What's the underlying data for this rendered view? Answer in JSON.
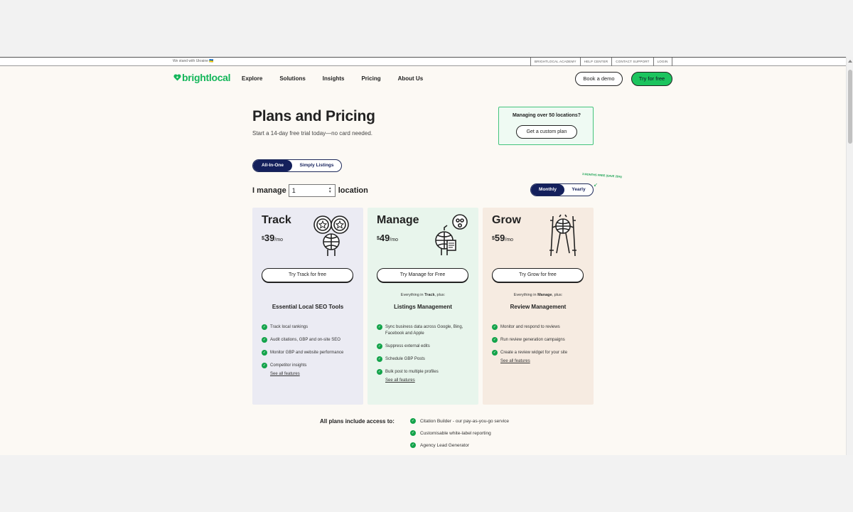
{
  "topbar": {
    "ukraine_text": "We stand with Ukraine 🇺🇦",
    "links": [
      "BRIGHTLOCAL ACADEMY",
      "HELP CENTER",
      "CONTACT SUPPORT",
      "LOGIN"
    ]
  },
  "nav": {
    "logo": "brightlocal",
    "items": [
      "Explore",
      "Solutions",
      "Insights",
      "Pricing",
      "About Us"
    ],
    "book_demo": "Book a demo",
    "try_free": "Try for free"
  },
  "hero": {
    "title": "Plans and Pricing",
    "subtitle": "Start a 14-day free trial today—no card needed."
  },
  "custom_plan": {
    "question": "Managing over 50 locations?",
    "button": "Get a custom plan"
  },
  "product_toggle": {
    "active": "All-In-One",
    "inactive": "Simply Listings"
  },
  "locations": {
    "label_before": "I manage",
    "value": "1",
    "label_after": "location"
  },
  "billing_toggle": {
    "active": "Monthly",
    "inactive": "Yearly",
    "promo": "3 MONTHS FREE (SAVE 25%)"
  },
  "plans": [
    {
      "name": "Track",
      "currency": "$",
      "price": "39",
      "period": "/mo",
      "cta": "Try Track for free",
      "plus_prefix": "",
      "plus_plan": "",
      "plus_suffix": "",
      "heading": "Essential Local SEO Tools",
      "features": [
        "Track local rankings",
        "Audit citations, GBP and on-site SEO",
        "Monitor GBP and website performance",
        "Competitor insights"
      ],
      "see_all": "See all features"
    },
    {
      "name": "Manage",
      "currency": "$",
      "price": "49",
      "period": "/mo",
      "cta": "Try Manage for Free",
      "plus_prefix": "Everything in ",
      "plus_plan": "Track",
      "plus_suffix": ", plus:",
      "heading": "Listings Management",
      "features": [
        "Sync business data across Google, Bing, Facebook and Apple",
        "Suppress external edits",
        "Schedule GBP Posts",
        "Bulk post to multiple profiles"
      ],
      "see_all": "See all features"
    },
    {
      "name": "Grow",
      "currency": "$",
      "price": "59",
      "period": "/mo",
      "cta": "Try Grow for free",
      "plus_prefix": "Everything in ",
      "plus_plan": "Manage",
      "plus_suffix": ", plus:",
      "heading": "Review Management",
      "features": [
        "Monitor and respond to reviews",
        "Run review generation campaigns",
        "Create a review widget for your site"
      ],
      "see_all": "See all features"
    }
  ],
  "all_plans": {
    "label": "All plans include access to:",
    "items": [
      "Citation Builder - our pay-as-you-go service",
      "Customisable white-label reporting",
      "Agency Lead Generator"
    ]
  },
  "colors": {
    "brand_green": "#14b65a",
    "navy": "#14205c",
    "track_bg": "#ebebf3",
    "manage_bg": "#e8f5ec",
    "grow_bg": "#f6ebe1"
  }
}
